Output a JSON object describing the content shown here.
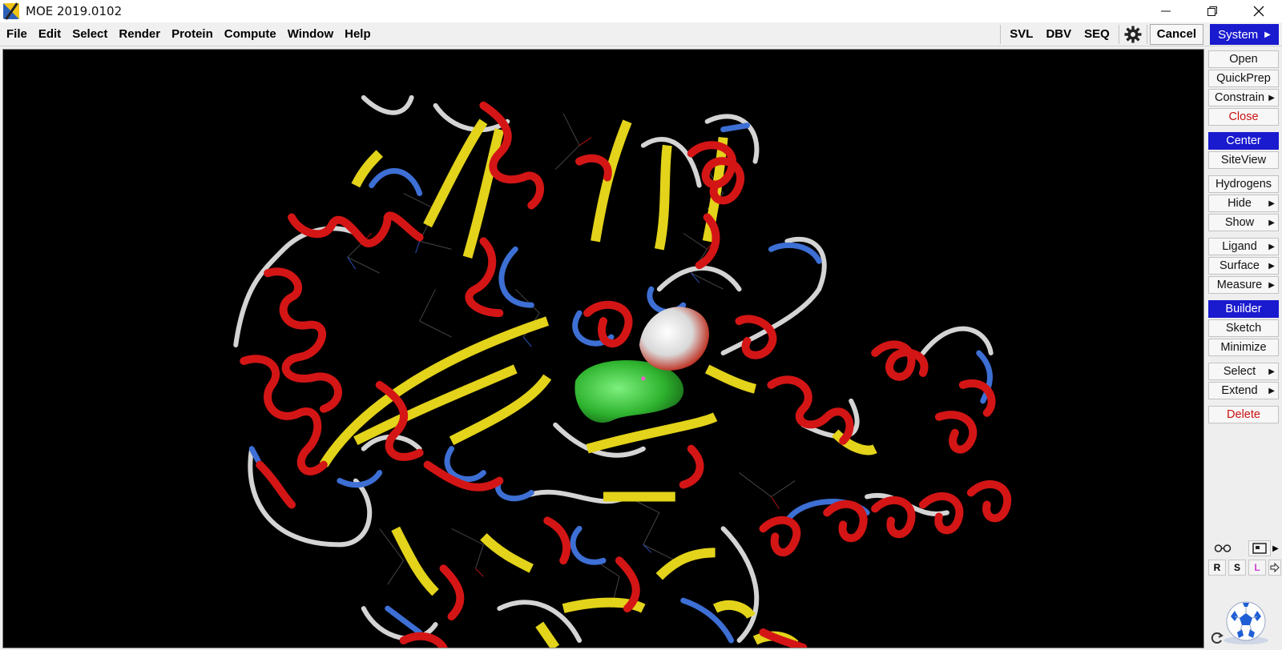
{
  "window": {
    "title": "MOE 2019.0102",
    "minimize_icon": "minimize-icon",
    "restore_icon": "restore-icon",
    "close_icon": "close-icon"
  },
  "menubar": {
    "items": [
      {
        "label": "File"
      },
      {
        "label": "Edit"
      },
      {
        "label": "Select"
      },
      {
        "label": "Render"
      },
      {
        "label": "Protein"
      },
      {
        "label": "Compute"
      },
      {
        "label": "Window"
      },
      {
        "label": "Help"
      }
    ],
    "right": {
      "svl": "SVL",
      "dbv": "DBV",
      "seq": "SEQ",
      "settings_icon": "gear-icon",
      "cancel": "Cancel",
      "system": "System"
    }
  },
  "viewport": {
    "content": "protein-ribbon-render",
    "colors": {
      "helix": "#d41515",
      "sheet": "#e3d31a",
      "coil": "#d4d4d4",
      "turn": "#3d6fd4",
      "ligand_surface": "#3ec83e"
    }
  },
  "panel": {
    "open": "Open",
    "quickprep": "QuickPrep",
    "constrain": "Constrain",
    "close": "Close",
    "center": "Center",
    "siteview": "SiteView",
    "hydrogens": "Hydrogens",
    "hide": "Hide",
    "show": "Show",
    "ligand": "Ligand",
    "surface": "Surface",
    "measure": "Measure",
    "builder": "Builder",
    "sketch": "Sketch",
    "minimize": "Minimize",
    "select": "Select",
    "extend": "Extend",
    "delete": "Delete",
    "arrow": "▶",
    "tools": {
      "glasses_icon": "glasses-icon",
      "picture_icon": "picture-icon",
      "r": "R",
      "s": "S",
      "l": "L",
      "export_icon": "export-arrow-icon",
      "ball_icon": "soccer-ball-icon",
      "reset_icon": "reset-icon"
    },
    "accent": "#1a1acf",
    "danger": "#cc1111"
  }
}
